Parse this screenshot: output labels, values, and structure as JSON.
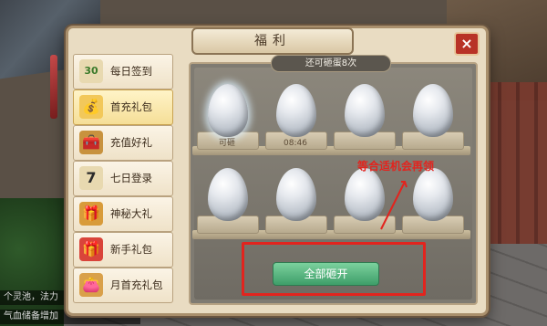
{
  "window": {
    "title": "福利",
    "close_icon": "×"
  },
  "sidebar": {
    "items": [
      {
        "label": "每日签到",
        "icon": "calendar-icon",
        "glyph": "30",
        "active": false
      },
      {
        "label": "首充礼包",
        "icon": "money-bag-icon",
        "glyph": "💰",
        "active": true
      },
      {
        "label": "充值好礼",
        "icon": "treasure-chest-icon",
        "glyph": "🧰",
        "active": false
      },
      {
        "label": "七日登录",
        "icon": "calendar-7-icon",
        "glyph": "7",
        "active": false
      },
      {
        "label": "神秘大礼",
        "icon": "mystery-chest-icon",
        "glyph": "🎁",
        "active": false
      },
      {
        "label": "新手礼包",
        "icon": "gift-box-icon",
        "glyph": "🎁",
        "active": false
      },
      {
        "label": "月首充礼包",
        "icon": "pouch-icon",
        "glyph": "👛",
        "active": false
      }
    ]
  },
  "panel": {
    "counter_text": "还可砸蛋8次",
    "eggs": [
      {
        "tag": "可砸"
      },
      {
        "tag": "08:46"
      },
      {
        "tag": ""
      },
      {
        "tag": ""
      },
      {
        "tag": ""
      },
      {
        "tag": ""
      },
      {
        "tag": ""
      },
      {
        "tag": ""
      }
    ],
    "open_all_label": "全部砸开"
  },
  "annotation": {
    "text": "等合适机会再领"
  },
  "chat": {
    "line1": "个灵池，法力",
    "line2": "气血储备增加"
  },
  "colors": {
    "accent_red": "#e2241e",
    "button_green": "#3e9e69"
  }
}
